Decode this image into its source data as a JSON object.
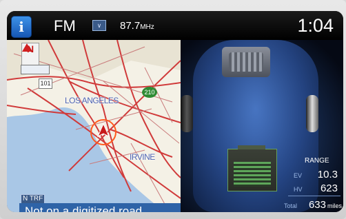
{
  "status_bar": {
    "info_icon": "i",
    "band": "FM",
    "radio_icon_text": "∨",
    "frequency": "87.7",
    "frequency_unit": "MHz",
    "clock": "1:04"
  },
  "map": {
    "compass_letter": "N",
    "city_labels": [
      "LOS ANGELES",
      "IRVINE"
    ],
    "route_shields": [
      "101",
      "210"
    ],
    "traffic_badge": "N TRF",
    "status_text": "Not on a digitized road"
  },
  "range": {
    "title": "RANGE",
    "ev_label": "EV",
    "ev_value": "10.3",
    "hv_label": "HV",
    "hv_value": "623",
    "total_label": "Total",
    "total_value": "633",
    "total_unit": "miles"
  },
  "colors": {
    "accent_blue": "#2e63a7",
    "highway_red": "#d03a3a",
    "ocean": "#a9c7e6",
    "land": "#f4f1e6"
  }
}
